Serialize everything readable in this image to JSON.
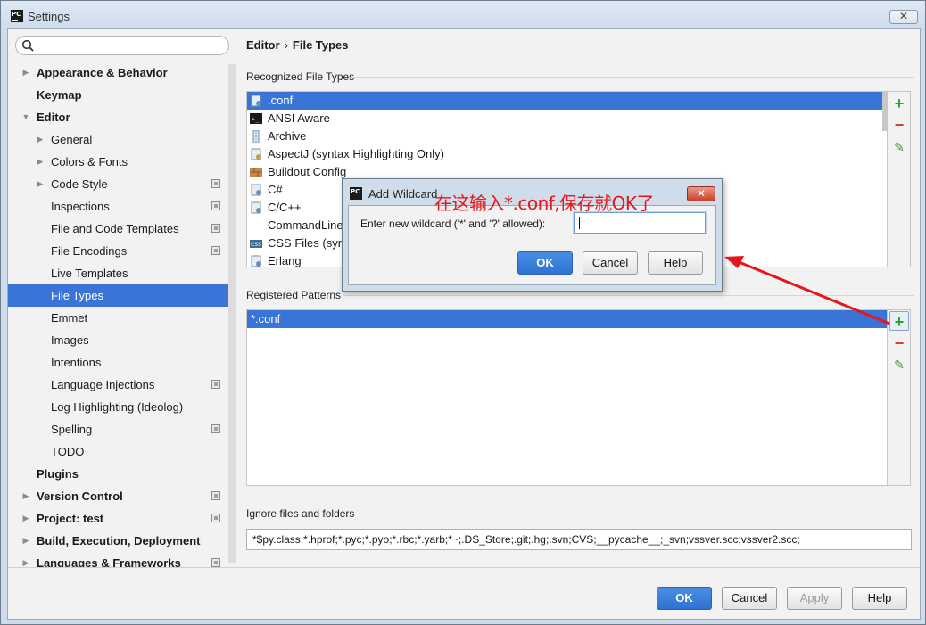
{
  "window": {
    "title": "Settings",
    "close_glyph": "✕"
  },
  "search": {
    "placeholder": "",
    "icon": "search-icon"
  },
  "sidebar": {
    "items": [
      {
        "label": "Appearance & Behavior",
        "bold": true,
        "arrow": "right",
        "level": 0,
        "proj": false
      },
      {
        "label": "Keymap",
        "bold": true,
        "arrow": "",
        "level": 0,
        "proj": false
      },
      {
        "label": "Editor",
        "bold": true,
        "arrow": "down",
        "level": 0,
        "proj": false
      },
      {
        "label": "General",
        "bold": false,
        "arrow": "right",
        "level": 1,
        "proj": false
      },
      {
        "label": "Colors & Fonts",
        "bold": false,
        "arrow": "right",
        "level": 1,
        "proj": false
      },
      {
        "label": "Code Style",
        "bold": false,
        "arrow": "right",
        "level": 1,
        "proj": true
      },
      {
        "label": "Inspections",
        "bold": false,
        "arrow": "",
        "level": 1,
        "proj": true
      },
      {
        "label": "File and Code Templates",
        "bold": false,
        "arrow": "",
        "level": 1,
        "proj": true
      },
      {
        "label": "File Encodings",
        "bold": false,
        "arrow": "",
        "level": 1,
        "proj": true
      },
      {
        "label": "Live Templates",
        "bold": false,
        "arrow": "",
        "level": 1,
        "proj": false
      },
      {
        "label": "File Types",
        "bold": false,
        "arrow": "",
        "level": 1,
        "proj": false,
        "selected": true
      },
      {
        "label": "Emmet",
        "bold": false,
        "arrow": "",
        "level": 1,
        "proj": false
      },
      {
        "label": "Images",
        "bold": false,
        "arrow": "",
        "level": 1,
        "proj": false
      },
      {
        "label": "Intentions",
        "bold": false,
        "arrow": "",
        "level": 1,
        "proj": false
      },
      {
        "label": "Language Injections",
        "bold": false,
        "arrow": "",
        "level": 1,
        "proj": true
      },
      {
        "label": "Log Highlighting (Ideolog)",
        "bold": false,
        "arrow": "",
        "level": 1,
        "proj": false
      },
      {
        "label": "Spelling",
        "bold": false,
        "arrow": "",
        "level": 1,
        "proj": true
      },
      {
        "label": "TODO",
        "bold": false,
        "arrow": "",
        "level": 1,
        "proj": false
      },
      {
        "label": "Plugins",
        "bold": true,
        "arrow": "",
        "level": 0,
        "proj": false
      },
      {
        "label": "Version Control",
        "bold": true,
        "arrow": "right",
        "level": 0,
        "proj": true
      },
      {
        "label": "Project: test",
        "bold": true,
        "arrow": "right",
        "level": 0,
        "proj": true
      },
      {
        "label": "Build, Execution, Deployment",
        "bold": true,
        "arrow": "right",
        "level": 0,
        "proj": false
      },
      {
        "label": "Languages & Frameworks",
        "bold": true,
        "arrow": "right",
        "level": 0,
        "proj": true
      }
    ]
  },
  "content": {
    "breadcrumb": {
      "parent": "Editor",
      "separator": "›",
      "current": "File Types"
    },
    "recognized_label": "Recognized File Types",
    "file_types": [
      {
        "name": ".conf",
        "icon": "config-file-icon",
        "selected": true
      },
      {
        "name": "ANSI Aware",
        "icon": "terminal-icon"
      },
      {
        "name": "Archive",
        "icon": "archive-icon"
      },
      {
        "name": "AspectJ (syntax Highlighting Only)",
        "icon": "aspectj-file-icon"
      },
      {
        "name": "Buildout Config",
        "icon": "buildout-icon"
      },
      {
        "name": "C#",
        "icon": "csharp-file-icon"
      },
      {
        "name": "C/C++",
        "icon": "cpp-file-icon"
      },
      {
        "name": "CommandLine",
        "icon": "commandline-icon"
      },
      {
        "name": "CSS Files (synta",
        "icon": "css-file-icon"
      },
      {
        "name": "Erlang",
        "icon": "erlang-file-icon"
      }
    ],
    "registered_label": "Registered Patterns",
    "patterns": [
      {
        "name": "*.conf",
        "selected": true
      }
    ],
    "ignore_label": "Ignore files and folders",
    "ignore_value": "*$py.class;*.hprof;*.pyc;*.pyo;*.rbc;*.yarb;*~;.DS_Store;.git;.hg;.svn;CVS;__pycache__;_svn;vssver.scc;vssver2.scc;",
    "tools": {
      "add": "+",
      "remove": "−",
      "edit": "✎"
    }
  },
  "buttons": {
    "ok": "OK",
    "cancel": "Cancel",
    "apply": "Apply",
    "help": "Help"
  },
  "dialog": {
    "title": "Add Wildcard",
    "close_glyph": "✕",
    "label": "Enter new wildcard ('*' and '?' allowed):",
    "input_value": "",
    "ok": "OK",
    "cancel": "Cancel",
    "help": "Help"
  },
  "annotation": {
    "text": "在这输入*.conf,保存就OK了",
    "color": "#e8151b"
  },
  "colors": {
    "selection": "#3875d7",
    "primary_button": "#3a7fdc",
    "add": "#2aa52a",
    "remove": "#d43c3c"
  }
}
